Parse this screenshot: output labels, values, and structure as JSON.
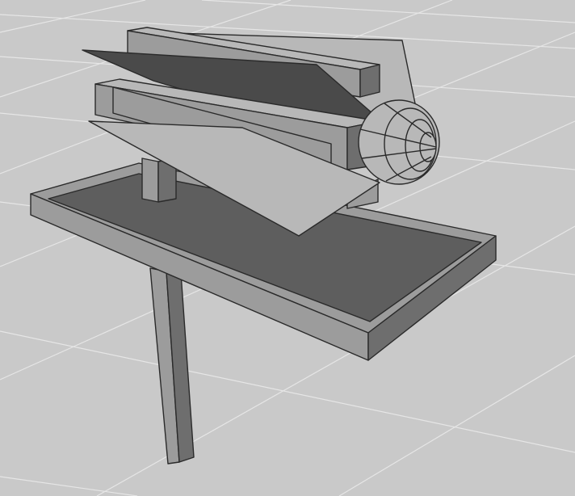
{
  "viewport": {
    "background": "#c9c9c9",
    "grid_line_color": "#e6e6e6",
    "edge_color": "#2a2a2a",
    "palette": {
      "light": "#b8b8b8",
      "mid": "#9c9c9c",
      "dark": "#6e6e6e",
      "darker": "#5e5e5e",
      "darkest": "#4a4a4a"
    }
  },
  "scene": {
    "objects": [
      {
        "name": "support-post",
        "shading": "mid"
      },
      {
        "name": "tray-base",
        "shading": "darker"
      },
      {
        "name": "back-panel",
        "shading": "light"
      },
      {
        "name": "top-rail",
        "shading": "mid"
      },
      {
        "name": "upper-fin",
        "shading": "darkest"
      },
      {
        "name": "fuselage-body",
        "shading": "light"
      },
      {
        "name": "lower-fin",
        "shading": "light"
      },
      {
        "name": "nose-cone",
        "shading": "light"
      }
    ]
  }
}
